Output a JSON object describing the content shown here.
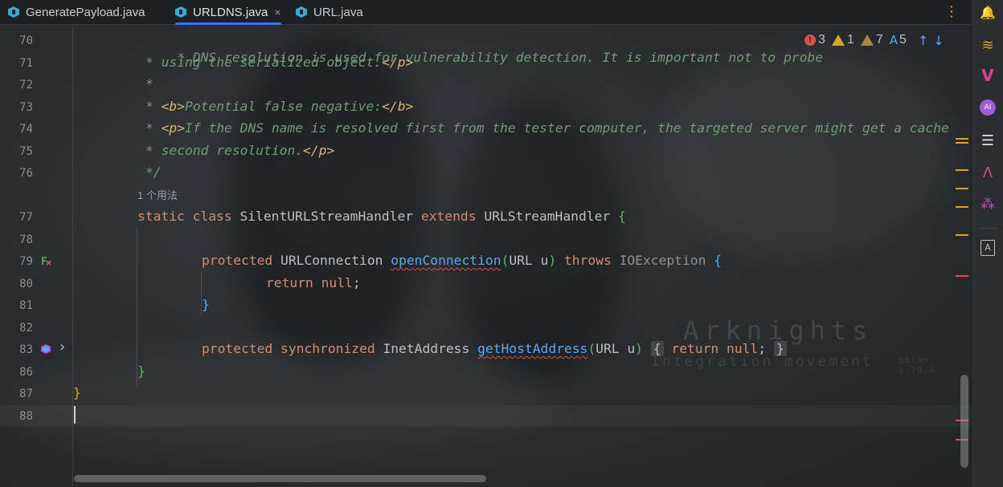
{
  "tabs": [
    {
      "label": "GeneratePayload.java",
      "active": false,
      "closable": false
    },
    {
      "label": "URLDNS.java",
      "active": true,
      "closable": true,
      "close_glyph": "×"
    },
    {
      "label": "URL.java",
      "active": false,
      "closable": false
    }
  ],
  "tab_menu_glyph": "⋮",
  "inspections": {
    "errors": "3",
    "warnings": "1",
    "weak_warnings": "7",
    "typos": "5",
    "typo_glyph": "A",
    "up_arrow": "↑",
    "down_arrow": "↓",
    "error_glyph": "!"
  },
  "gutter": {
    "line_numbers": [
      "70",
      "71",
      "72",
      "73",
      "74",
      "75",
      "76",
      "77",
      "78",
      "79",
      "80",
      "81",
      "82",
      "83",
      "86",
      "87",
      "88"
    ],
    "fold_glyph": "›"
  },
  "code": {
    "l70": "* DNS resolution is used for vulnerability detection. It is important not to probe",
    "l71_pre": "* using the serialized object.",
    "l71_tag": "</p>",
    "l72": "*",
    "l73_pre": "* ",
    "l73_tag1": "<b>",
    "l73_text": "Potential false negative:",
    "l73_tag2": "</b>",
    "l74_pre": "* ",
    "l74_tag": "<p>",
    "l74_text": "If the DNS name is resolved first from the tester computer, the targeted server might get a cache",
    "l75_pre": "* second resolution.",
    "l75_tag": "</p>",
    "l76": "*/",
    "usage_hint": "1 个用法",
    "l77_kw1": "static class ",
    "l77_name": "SilentURLStreamHandler ",
    "l77_kw2": "extends ",
    "l77_base": "URLStreamHandler ",
    "l77_brace": "{",
    "l79_kw": "protected ",
    "l79_type": "URLConnection ",
    "l79_fn": "openConnection",
    "l79_paren": "(",
    "l79_params": "URL u",
    "l79_paren2": ") ",
    "l79_throws": "throws ",
    "l79_exc": "IOException ",
    "l79_brace": "{",
    "l80_kw": "return null",
    "l80_semi": ";",
    "l81_brace": "}",
    "l83_kw": "protected synchronized ",
    "l83_type": "InetAddress ",
    "l83_fn": "getHostAddress",
    "l83_paren": "(",
    "l83_params": "URL u",
    "l83_paren2": ")",
    "l83_fold_open": "{",
    "l83_body": " return null",
    "l83_semi": ";",
    "l83_fold_close": "}",
    "l86_brace": "}",
    "l87_brace": "}"
  },
  "watermark": {
    "title": "Arknights",
    "subtitle": "Integration movement",
    "small": "qbian 1.19.4"
  },
  "colors": {
    "accent": "#3574f0",
    "error": "#d7514b",
    "warning": "#d4a72c",
    "comment": "#6f9b78",
    "keyword": "#cf8e6d",
    "function": "#56a8f5"
  },
  "toolstrip": [
    {
      "name": "notifications-icon",
      "glyph": "🔔"
    },
    {
      "name": "database-icon",
      "glyph": "≋"
    },
    {
      "name": "vue-icon",
      "glyph": "V"
    },
    {
      "name": "ai-assistant-icon",
      "glyph": "AI"
    },
    {
      "name": "structure-icon",
      "glyph": "☰"
    },
    {
      "name": "ant-build-icon",
      "glyph": "Λ"
    },
    {
      "name": "dependencies-icon",
      "glyph": "⁂"
    },
    {
      "name": "translate-icon",
      "glyph": "A"
    }
  ]
}
